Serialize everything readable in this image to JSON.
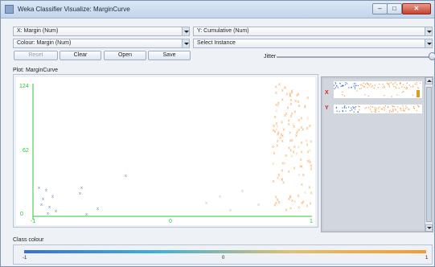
{
  "window": {
    "title": "Weka Classifier Visualize: MarginCurve",
    "minimize": "–",
    "maximize": "□",
    "close": "✕"
  },
  "controls": {
    "x_axis": "X: Margin (Num)",
    "y_axis": "Y: Cumulative (Num)",
    "colour": "Colour: Margin (Num)",
    "instance": "Select Instance",
    "buttons": {
      "reset": "Reset",
      "clear": "Clear",
      "open": "Open",
      "save": "Save"
    },
    "jitter_label": "Jitter"
  },
  "plot": {
    "label": "Plot: MarginCurve",
    "y_ticks": [
      "124",
      "62",
      "0"
    ],
    "x_ticks": [
      "-1",
      "0",
      "1"
    ]
  },
  "side_panel": {
    "x_tag": "X",
    "y_tag": "Y"
  },
  "class_colour": {
    "label": "Class colour",
    "ticks": [
      "-1",
      "0",
      "1"
    ]
  },
  "colors": {
    "low": "#3a6fd6",
    "mid": "#40b0d9",
    "high": "#f59a30",
    "axis": "#27c83a"
  }
}
